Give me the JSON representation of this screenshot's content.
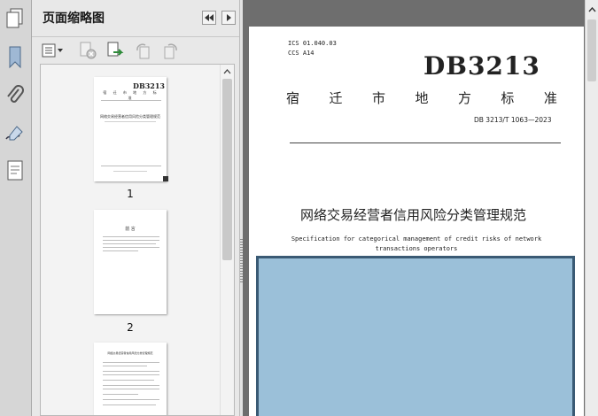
{
  "panel": {
    "title": "页面缩略图",
    "thumbnails": [
      {
        "label": "1",
        "mini_logo": "DB3213",
        "mini_subtitle": "宿 迁 市 地 方 标 准",
        "mini_title": "网络交易经营者信用风险分类管理规范"
      },
      {
        "label": "2",
        "mini_heading": "前  言"
      },
      {
        "label": "",
        "mini_heading": "网络交易经营者信用风险分类管理规范"
      }
    ]
  },
  "left_strip": {
    "icons": [
      "pages-icon",
      "bookmark-icon",
      "attachment-icon",
      "signature-icon",
      "layers-icon"
    ]
  },
  "document": {
    "ics": "ICS  01.040.03",
    "ccs": "CCS  A14",
    "logo": "DB3213",
    "subtitle_chars": [
      "宿",
      "迁",
      "市",
      "地",
      "方",
      "标",
      "准"
    ],
    "standard_number": "DB 3213/T 1063—2023",
    "title_cn": "网络交易经营者信用风险分类管理规范",
    "title_en_line1": "Specification for categorical management of credit risks of network",
    "title_en_line2": "transactions operators",
    "cover_color": "#9bc0d9",
    "cover_border_color": "#3a5a74"
  }
}
